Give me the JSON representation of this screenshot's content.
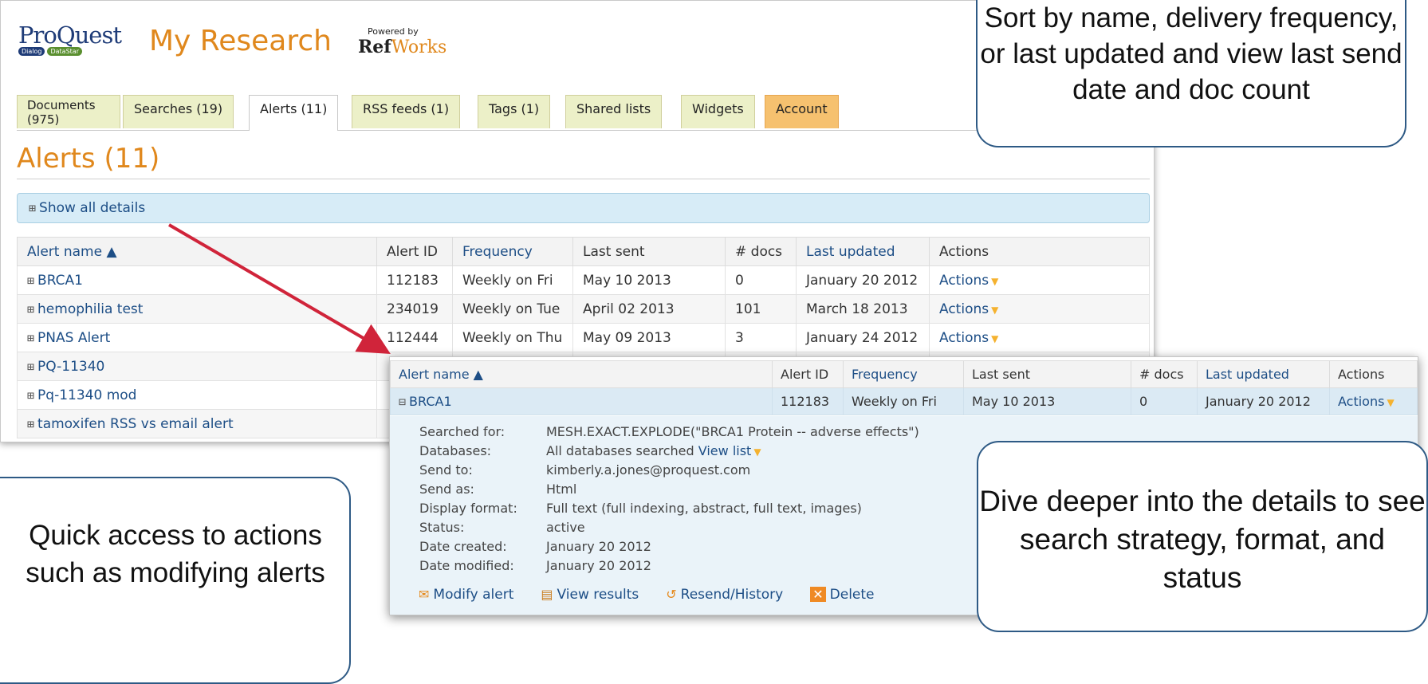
{
  "header": {
    "logo_main": "ProQuest",
    "logo_sub1": "Dialog",
    "logo_sub2": "DataStar",
    "app_title": "My Research",
    "powered_by": "Powered by",
    "refworks_ref": "Ref",
    "refworks_works": "Works"
  },
  "tabs": [
    {
      "label": "Documents (975)"
    },
    {
      "label": "Searches (19)"
    },
    {
      "label": "Alerts (11)"
    },
    {
      "label": "RSS feeds (1)"
    },
    {
      "label": "Tags (1)"
    },
    {
      "label": "Shared lists"
    },
    {
      "label": "Widgets"
    },
    {
      "label": "Account"
    }
  ],
  "page_heading": "Alerts (11)",
  "show_all_details": "Show all details",
  "table": {
    "headers": {
      "name": "Alert name",
      "id": "Alert ID",
      "frequency": "Frequency",
      "last_sent": "Last sent",
      "docs": "# docs",
      "last_updated": "Last updated",
      "actions": "Actions"
    },
    "rows": [
      {
        "name": "BRCA1",
        "id": "112183",
        "frequency": "Weekly on Fri",
        "last_sent": "May 10 2013",
        "docs": "0",
        "last_updated": "January 20 2012",
        "actions": "Actions"
      },
      {
        "name": "hemophilia test",
        "id": "234019",
        "frequency": "Weekly on Tue",
        "last_sent": "April 02 2013",
        "docs": "101",
        "last_updated": "March 18 2013",
        "actions": "Actions"
      },
      {
        "name": "PNAS Alert",
        "id": "112444",
        "frequency": "Weekly on Thu",
        "last_sent": "May 09 2013",
        "docs": "3",
        "last_updated": "January 24 2012",
        "actions": "Actions"
      },
      {
        "name": "PQ-11340"
      },
      {
        "name": "Pq-11340 mod"
      },
      {
        "name": "tamoxifen RSS vs email alert"
      }
    ]
  },
  "detail": {
    "row": {
      "name": "BRCA1",
      "id": "112183",
      "frequency": "Weekly on Fri",
      "last_sent": "May 10 2013",
      "docs": "0",
      "last_updated": "January 20 2012",
      "actions": "Actions"
    },
    "fields": [
      {
        "label": "Searched for:",
        "value": "MESH.EXACT.EXPLODE(\"BRCA1 Protein -- adverse effects\")"
      },
      {
        "label": "Databases:",
        "value": "All databases searched",
        "link": "View list"
      },
      {
        "label": "Send to:",
        "value": "kimberly.a.jones@proquest.com"
      },
      {
        "label": "Send as:",
        "value": "Html"
      },
      {
        "label": "Display format:",
        "value": "Full text (full indexing, abstract, full text, images)"
      },
      {
        "label": "Status:",
        "value": "active"
      },
      {
        "label": "Date created:",
        "value": "January 20 2012"
      },
      {
        "label": "Date modified:",
        "value": "January 20 2012"
      }
    ],
    "actions": {
      "modify": "Modify alert",
      "view": "View results",
      "resend": "Resend/History",
      "delete": "Delete"
    }
  },
  "callouts": {
    "sort": "Sort by name, delivery frequency, or last updated and view last send date and doc count",
    "actions": "Quick access to actions such as modifying alerts",
    "details": "Dive deeper into the details to see search strategy, format, and status"
  },
  "colors": {
    "accent_orange": "#e0881d",
    "link_blue": "#1d4e86",
    "arrow_red": "#d0243a",
    "callout_border": "#2e5a85"
  }
}
